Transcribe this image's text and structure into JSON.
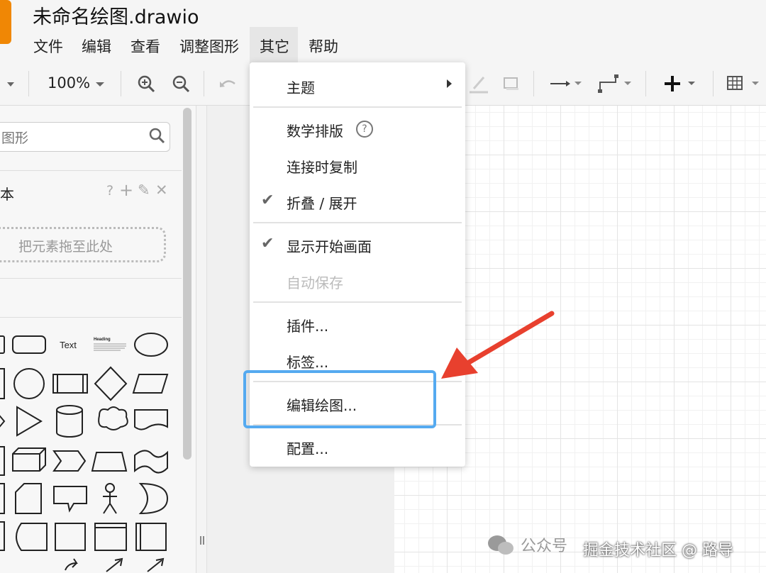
{
  "window": {
    "title": "未命名绘图.drawio"
  },
  "menubar": {
    "items": [
      {
        "label": "文件"
      },
      {
        "label": "编辑"
      },
      {
        "label": "查看"
      },
      {
        "label": "调整图形"
      },
      {
        "label": "其它"
      },
      {
        "label": "帮助"
      }
    ]
  },
  "toolbar": {
    "zoom": "100%"
  },
  "sidebar": {
    "search_text": "图形",
    "scratchpad_title": "本",
    "scratchpad_actions": [
      "?",
      "+",
      "✎",
      "✕"
    ],
    "dropzone_label": "把元素拖至此处",
    "shape_labels": {
      "text": "Text",
      "heading": "Heading"
    }
  },
  "dropdown": {
    "items": [
      {
        "label": "主题",
        "submenu": true
      },
      {
        "label": "数学排版",
        "help": "?"
      },
      {
        "label": "连接时复制"
      },
      {
        "label": "折叠 / 展开",
        "checked": true
      },
      {
        "label": "显示开始画面",
        "checked": true
      },
      {
        "label": "自动保存",
        "disabled": true
      },
      {
        "label": "插件..."
      },
      {
        "label": "标签..."
      },
      {
        "label": "编辑绘图...",
        "highlighted": true
      },
      {
        "label": "配置..."
      }
    ]
  },
  "watermark": {
    "text1": "公众号",
    "text2": "掘金技术社区 @ 路导"
  },
  "colors": {
    "highlight": "#55aaf0",
    "arrow": "#e8402e",
    "app_icon": "#f08705"
  }
}
